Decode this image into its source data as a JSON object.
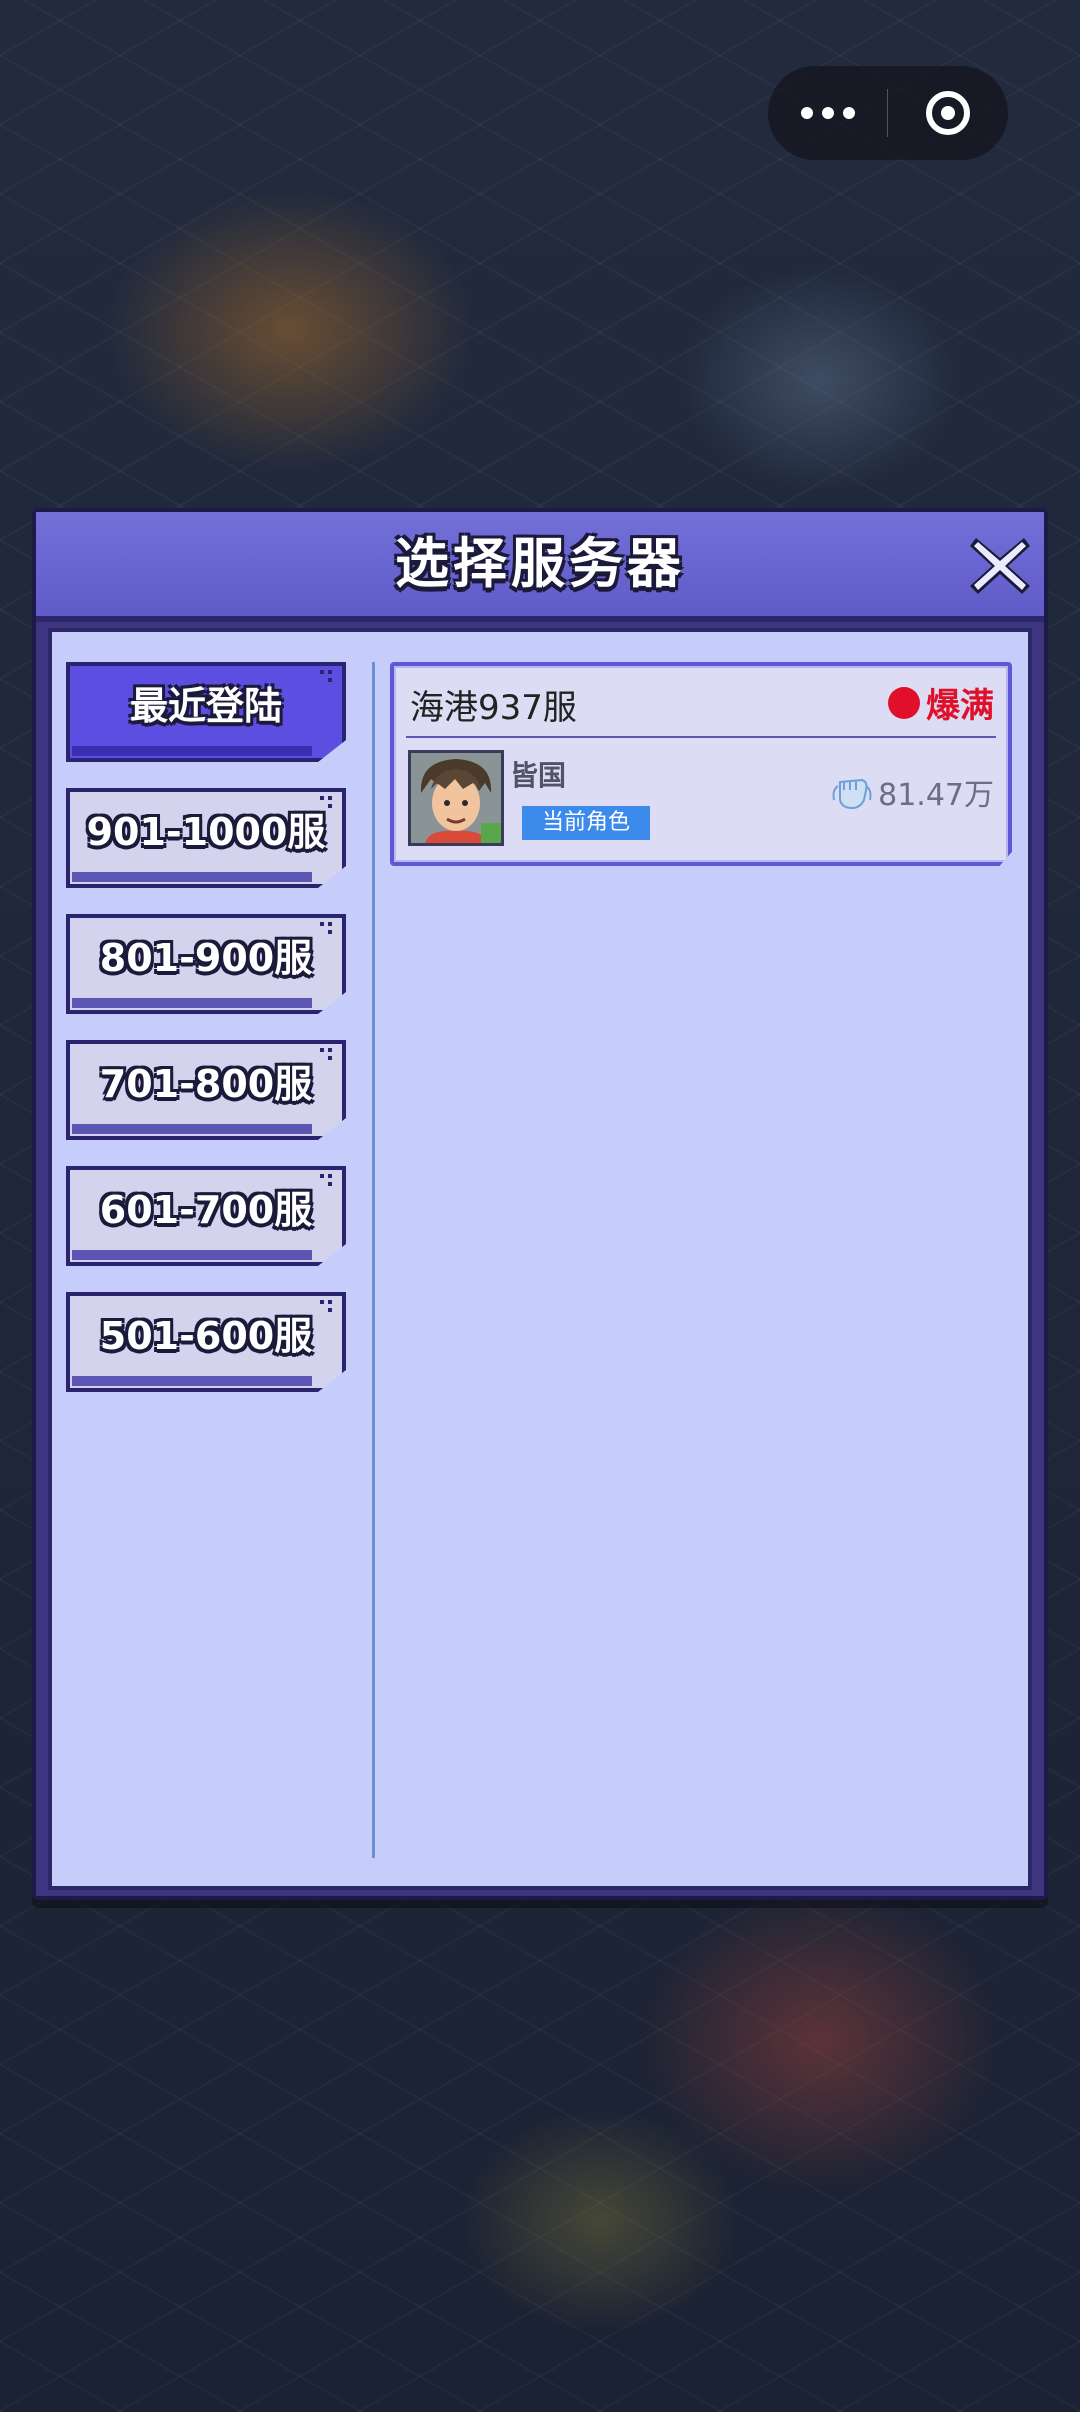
{
  "dialog": {
    "title": "选择服务器",
    "close_icon": "close-icon"
  },
  "nav": {
    "items": [
      {
        "label": "最近登陆",
        "active": true
      },
      {
        "label": "901-1000服",
        "active": false
      },
      {
        "label": "801-900服",
        "active": false
      },
      {
        "label": "701-800服",
        "active": false
      },
      {
        "label": "601-700服",
        "active": false
      },
      {
        "label": "501-600服",
        "active": false
      }
    ]
  },
  "server": {
    "name": "海港937服",
    "status": "爆满",
    "status_color": "#e0102a",
    "player_name": "皆国",
    "role_badge": "当前角色",
    "power": "81.47万",
    "power_icon": "fist-icon"
  },
  "capsule": {
    "more_icon": "more-icon",
    "exit_icon": "target-icon"
  }
}
